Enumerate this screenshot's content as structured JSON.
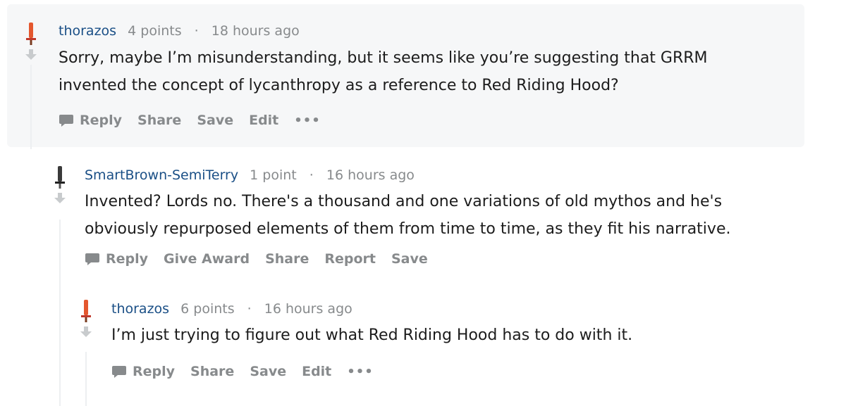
{
  "comments": [
    {
      "author": "thorazos",
      "points": "4 points",
      "separator": "·",
      "time": "18 hours ago",
      "body_lines": [
        "Sorry, maybe I’m misunderstanding, but it seems like you’re suggesting that GRRM",
        "invented the concept of lycanthropy as a reference to Red Riding Hood?"
      ],
      "actions": [
        "Reply",
        "Share",
        "Save",
        "Edit"
      ],
      "more": "•••",
      "flair_color": "#e4572e"
    },
    {
      "author": "SmartBrown-SemiTerry",
      "points": "1 point",
      "separator": "·",
      "time": "16 hours ago",
      "body_lines": [
        "Invented? Lords no. There's a thousand and one variations of old mythos and he's",
        "obviously repurposed elements of them from time to time, as they fit his narrative."
      ],
      "actions": [
        "Reply",
        "Give Award",
        "Share",
        "Report",
        "Save"
      ],
      "flair_color": "#3a3a3a"
    },
    {
      "author": "thorazos",
      "points": "6 points",
      "separator": "·",
      "time": "16 hours ago",
      "body_lines": [
        "I’m just trying to figure out what Red Riding Hood has to do with it."
      ],
      "actions": [
        "Reply",
        "Share",
        "Save",
        "Edit"
      ],
      "more": "•••",
      "flair_color": "#e4572e"
    }
  ],
  "colors": {
    "author": "#1a4f86",
    "meta": "#878a8c",
    "body": "#1c1c1c",
    "highlight_bg": "#f6f7f8"
  },
  "icons": {
    "upvote": "sword-upvote-icon",
    "downvote": "downvote-arrow-icon",
    "reply": "speech-bubble-icon"
  }
}
